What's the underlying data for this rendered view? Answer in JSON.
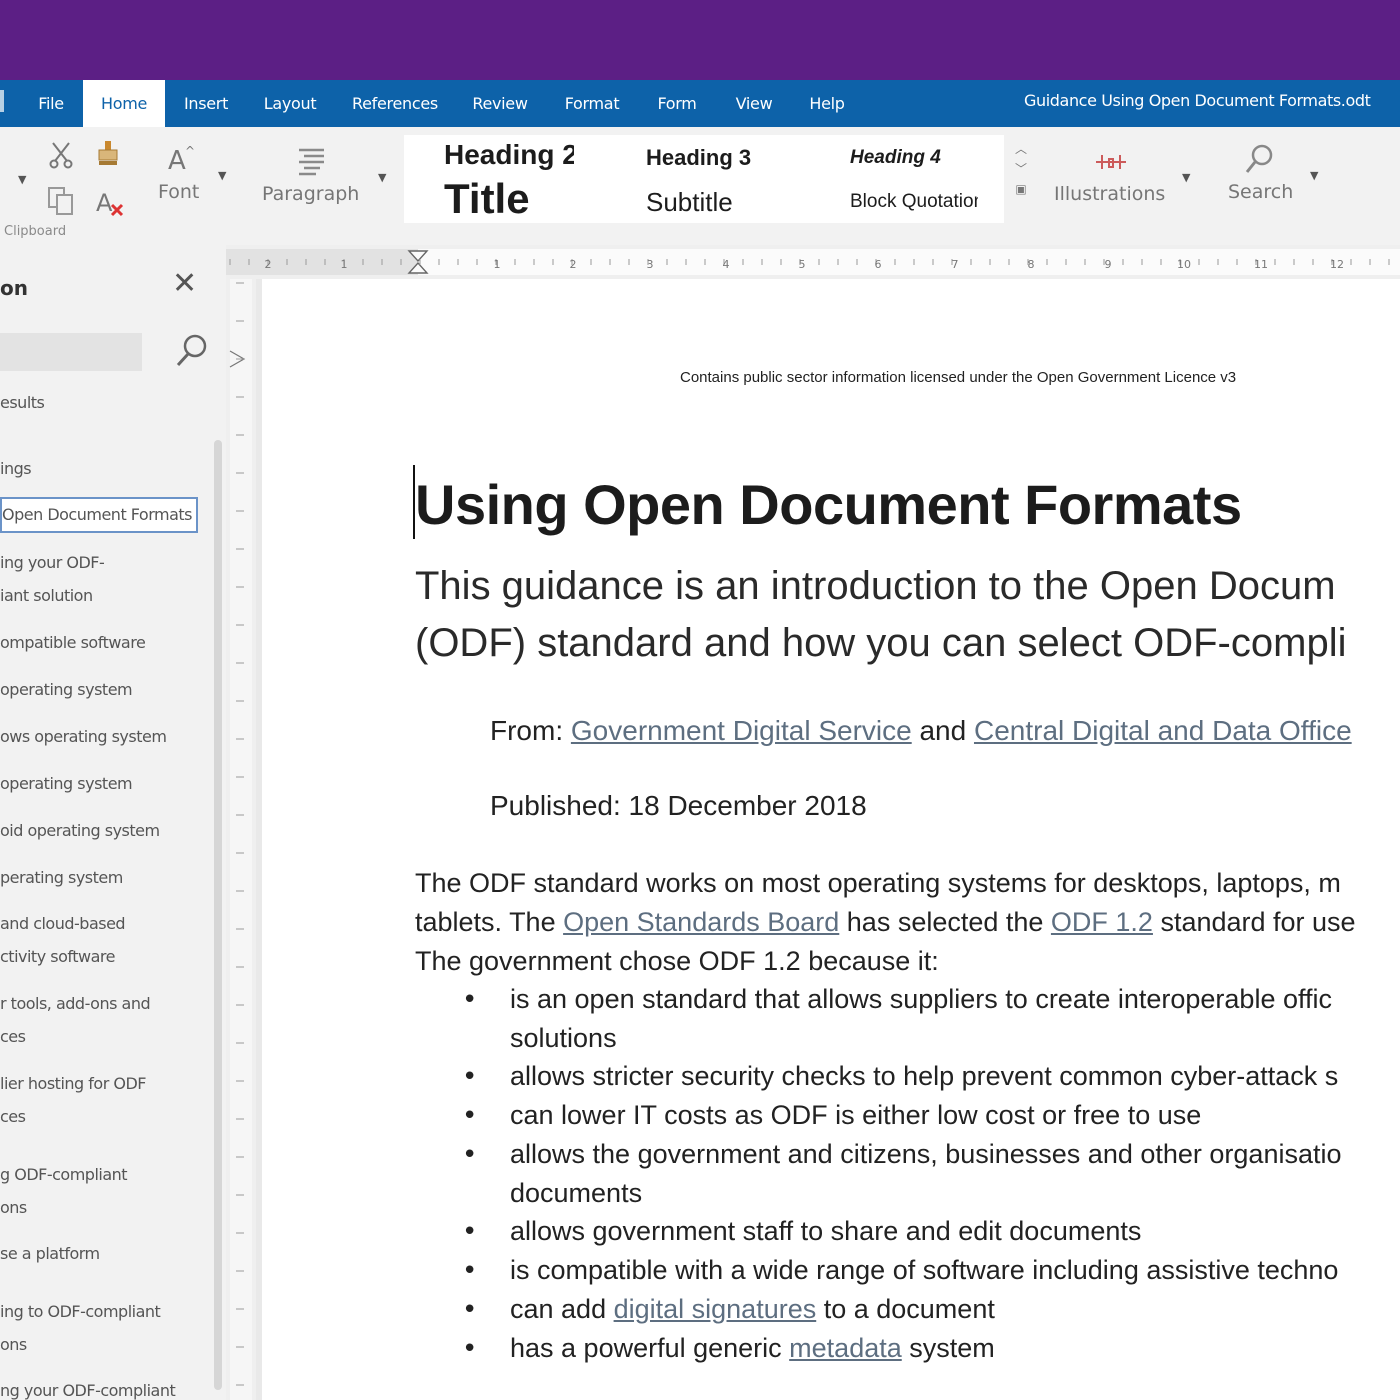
{
  "menu": {
    "tabs": [
      {
        "label": "File"
      },
      {
        "label": "Home"
      },
      {
        "label": "Insert"
      },
      {
        "label": "Layout"
      },
      {
        "label": "References"
      },
      {
        "label": "Review"
      },
      {
        "label": "Format"
      },
      {
        "label": "Form"
      },
      {
        "label": "View"
      },
      {
        "label": "Help"
      }
    ],
    "active_tab": "Home",
    "filename": "Guidance Using Open Document Formats.odt"
  },
  "ribbon": {
    "clipboard_label": "Clipboard",
    "font_label": "Font",
    "paragraph_label": "Paragraph",
    "illustrations_label": "Illustrations",
    "search_label": "Search",
    "styles": {
      "heading2": "Heading 2",
      "heading3": "Heading 3",
      "heading4": "Heading 4",
      "title": "Title",
      "subtitle": "Subtitle",
      "block_quotation": "Block Quotation"
    }
  },
  "navigator": {
    "title": "on",
    "search_placeholder": "",
    "items": [
      {
        "label": "esults"
      },
      {
        "label": "ings"
      },
      {
        "label": "Open Document Formats"
      },
      {
        "label": "ing your ODF-"
      },
      {
        "label": "iant solution"
      },
      {
        "label": "ompatible software"
      },
      {
        "label": "operating system"
      },
      {
        "label": "ows operating system"
      },
      {
        "label": " operating system"
      },
      {
        "label": "oid operating system"
      },
      {
        "label": "perating system"
      },
      {
        "label": "and cloud-based"
      },
      {
        "label": "ctivity software"
      },
      {
        "label": "r tools, add-ons and"
      },
      {
        "label": "ces"
      },
      {
        "label": "lier hosting for ODF"
      },
      {
        "label": "ces"
      },
      {
        "label": "g ODF-compliant"
      },
      {
        "label": "ons"
      },
      {
        "label": "se a platform"
      },
      {
        "label": "ing to ODF-compliant"
      },
      {
        "label": "ons"
      },
      {
        "label": "ng your ODF-compliant"
      }
    ]
  },
  "ruler": {
    "labels": [
      "2",
      "1",
      "1",
      "2",
      "3",
      "4",
      "5",
      "6",
      "7",
      "8",
      "9",
      "10",
      "11",
      "12"
    ]
  },
  "document": {
    "licence": "Contains public sector information licensed under the Open Government Licence v3",
    "title": "Using Open Document Formats",
    "subtitle_line1": "This guidance is an introduction to the Open Docum",
    "subtitle_line2": "(ODF) standard and how you can select ODF-compli",
    "from_label": "From: ",
    "from_link1": "Government Digital Service",
    "from_and": " and ",
    "from_link2": "Central Digital and Data Office",
    "published": "Published: 18 December 2018",
    "body_line1": "The ODF standard works on most operating systems for desktops, laptops, m",
    "body_line2_a": "tablets. The ",
    "body_line2_link1": "Open Standards Board",
    "body_line2_b": " has selected the ",
    "body_line2_link2": "ODF 1.2",
    "body_line2_c": " standard for use",
    "body_line3": "The government chose ODF 1.2 because it:",
    "bullet_glyph": "•",
    "bullets": {
      "b1_line1": "is an open standard that allows suppliers to create interoperable offic",
      "b1_line2": "solutions",
      "b2": "allows stricter security checks to help prevent common cyber-attack s",
      "b3": "can lower IT costs as ODF is either low cost or free to use",
      "b4_line1": "allows the government and citizens, businesses and other organisatio",
      "b4_line2": "documents",
      "b5": "allows government staff to share and edit documents",
      "b6": "is compatible with a wide range of software including assistive techno",
      "b7_a": "can add ",
      "b7_link": "digital signatures",
      "b7_b": " to a document",
      "b8_a": "has a powerful generic ",
      "b8_link": "metadata",
      "b8_b": " system"
    }
  },
  "icons": {
    "close": "close-icon",
    "search": "search-icon",
    "cut": "cut-icon",
    "paste": "paste-icon",
    "copy": "copy-icon",
    "format_paint": "format-paintbrush-icon",
    "font": "font-icon",
    "paragraph": "paragraph-icon",
    "illustrations": "illustrations-icon"
  },
  "colors": {
    "title_bar": "#5c1f85",
    "menu_bar": "#0d62a9",
    "link": "#5d6e80"
  }
}
